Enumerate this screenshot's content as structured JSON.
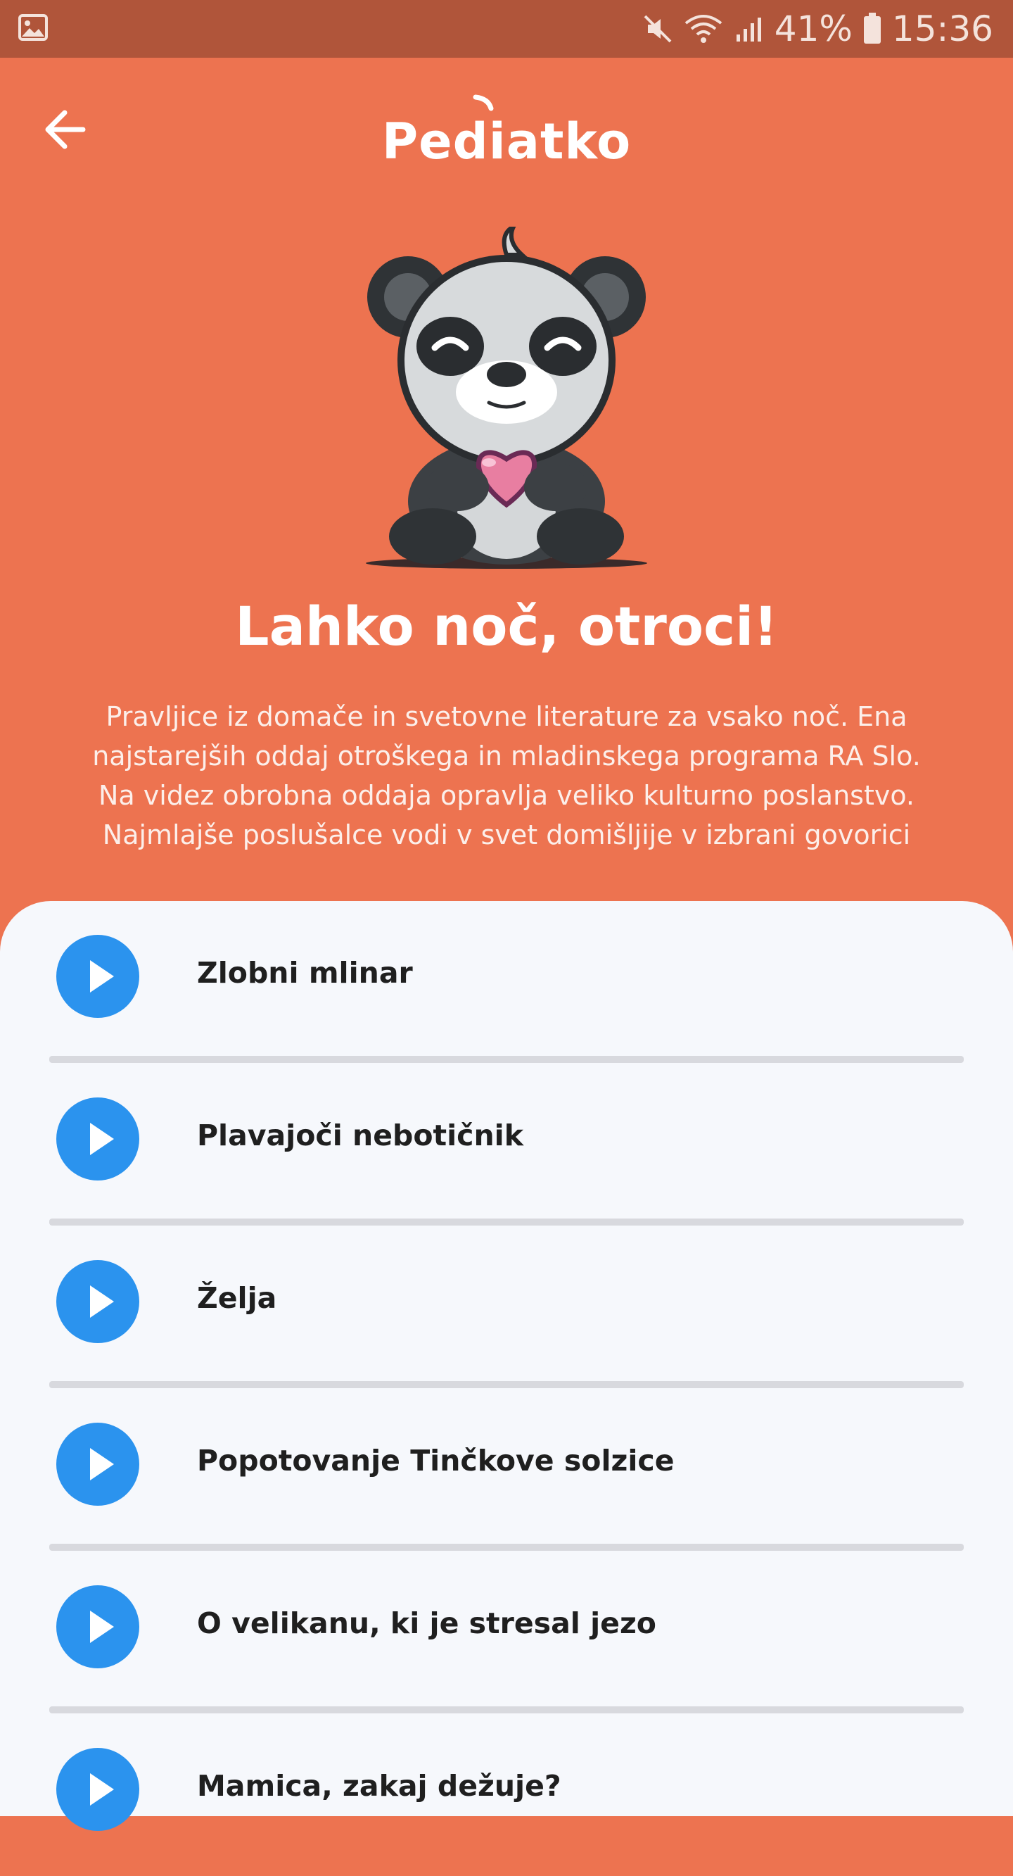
{
  "status_bar": {
    "battery": "41%",
    "time": "15:36",
    "icons": [
      "gallery-icon",
      "mute-icon",
      "wifi-icon",
      "signal-icon",
      "battery-icon"
    ]
  },
  "header": {
    "logo": "Pediatko",
    "back_icon": "back-arrow-icon"
  },
  "hero": {
    "title": "Lahko noč, otroci!",
    "description": "Pravljice iz domače in svetovne literature za vsako noč. Ena najstarejših oddaj otroškega in mladinskega programa RA Slo. Na videz obrobna oddaja opravlja veliko kulturno poslanstvo. Najmlajše poslušalce vodi v svet domišljije v izbrani govorici"
  },
  "episodes": [
    {
      "title": "Zlobni mlinar"
    },
    {
      "title": "Plavajoči nebotičnik"
    },
    {
      "title": "Želja"
    },
    {
      "title": "Popotovanje Tinčkove solzice"
    },
    {
      "title": "O velikanu, ki je stresal jezo"
    },
    {
      "title": "Mamica, zakaj dežuje?"
    }
  ],
  "colors": {
    "primary": "#ED7350",
    "status_bar": "#B0553A",
    "play_button": "#2B93EE",
    "list_background": "#F6F8FC"
  }
}
